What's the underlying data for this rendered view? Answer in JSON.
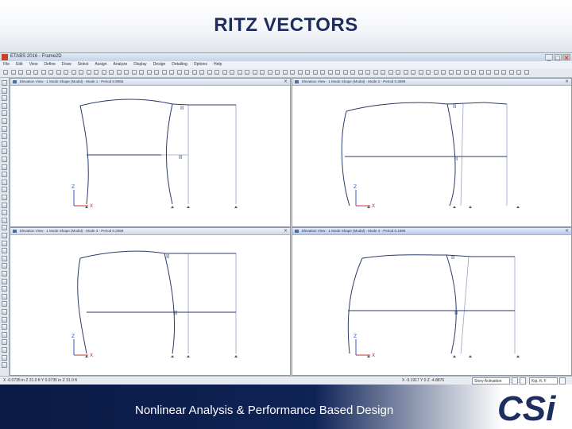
{
  "slide": {
    "title": "RITZ VECTORS",
    "footer_text": "Nonlinear Analysis & Performance Based Design",
    "logo_text": "CSi"
  },
  "app": {
    "window_title": "ETABS 2016 - Frame2D",
    "menu": [
      "File",
      "Edit",
      "View",
      "Define",
      "Draw",
      "Select",
      "Assign",
      "Analyze",
      "Display",
      "Design",
      "Detailing",
      "Options",
      "Help"
    ],
    "views": [
      {
        "title": "Elevation View - 1  Mode Shape (Modal) - Mode 1 - Period 0.9065",
        "active": false
      },
      {
        "title": "Elevation View - 1  Mode Shape (Modal) - Mode 2 - Period 0.3089",
        "active": false
      },
      {
        "title": "Elevation View - 1  Mode Shape (Modal) - Mode 3 - Period 0.2069",
        "active": false
      },
      {
        "title": "Elevation View - 1  Mode Shape (Modal) - Mode 4 - Period 0.1695",
        "active": true
      }
    ],
    "axis_labels": {
      "x": "X",
      "z": "Z"
    },
    "status": {
      "left": "X -0.0735 in   Z 31.0 ft     Y 0.0735 in   Z 31.0 ft",
      "coords": "X -3.1917  Y 0  Z -4.8876",
      "story_select": "Story Activation",
      "units_select": "Kip, ft, F"
    }
  },
  "icons": {
    "close": "close-icon",
    "minimize": "minimize-icon",
    "maximize": "maximize-icon",
    "app": "etabs-app-icon"
  },
  "colors": {
    "title": "#1f2d5c",
    "footer": "#0e2356",
    "mode_line": "#2b3a6b",
    "grid": "#9aa3c6",
    "axis_x": "#c03030",
    "axis_z": "#3050c0"
  }
}
